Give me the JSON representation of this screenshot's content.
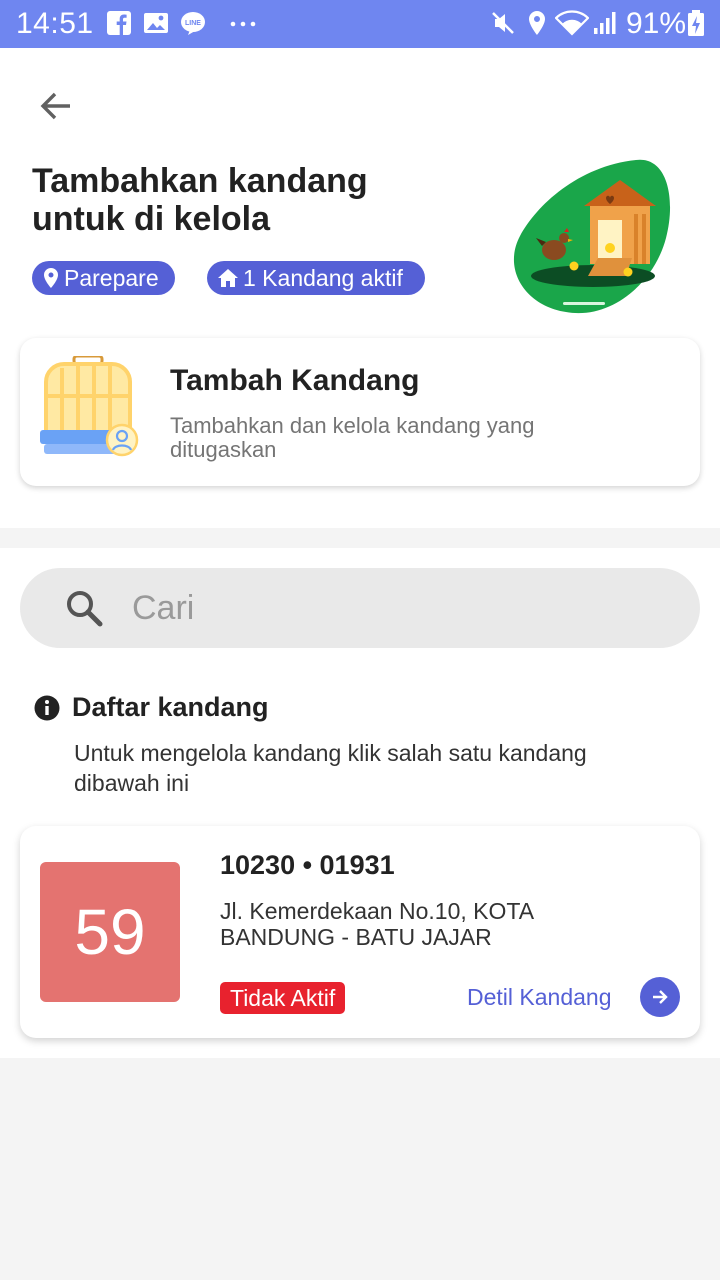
{
  "status_bar": {
    "time": "14:51",
    "battery": "91%",
    "left_icons": [
      "facebook-icon",
      "gallery-icon",
      "line-icon",
      "more-dots-icon"
    ],
    "right_icons": [
      "mute-icon",
      "location-icon",
      "wifi-icon",
      "signal-icon",
      "battery-icon"
    ]
  },
  "header": {
    "title": "Tambahkan kandang untuk di kelola",
    "location_chip": "Parepare",
    "active_chip": "1 Kandang aktif"
  },
  "add_card": {
    "title": "Tambah Kandang",
    "description": "Tambahkan dan kelola kandang yang ditugaskan"
  },
  "search": {
    "placeholder": "Cari",
    "value": ""
  },
  "list": {
    "title": "Daftar kandang",
    "description": "Untuk mengelola kandang klik salah satu kandang dibawah ini",
    "items": [
      {
        "age": "59",
        "id": "10230 • 01931",
        "address": "Jl. Kemerdekaan No.10, KOTA BANDUNG - BATU JAJAR",
        "status": "Tidak Aktif",
        "detail_label": "Detil Kandang"
      }
    ]
  },
  "colors": {
    "status_bar": "#6f86f0",
    "primary": "#5560d6",
    "age_box": "#e47370",
    "inactive_badge": "#e8222e",
    "illustration_green": "#1aa64a"
  }
}
